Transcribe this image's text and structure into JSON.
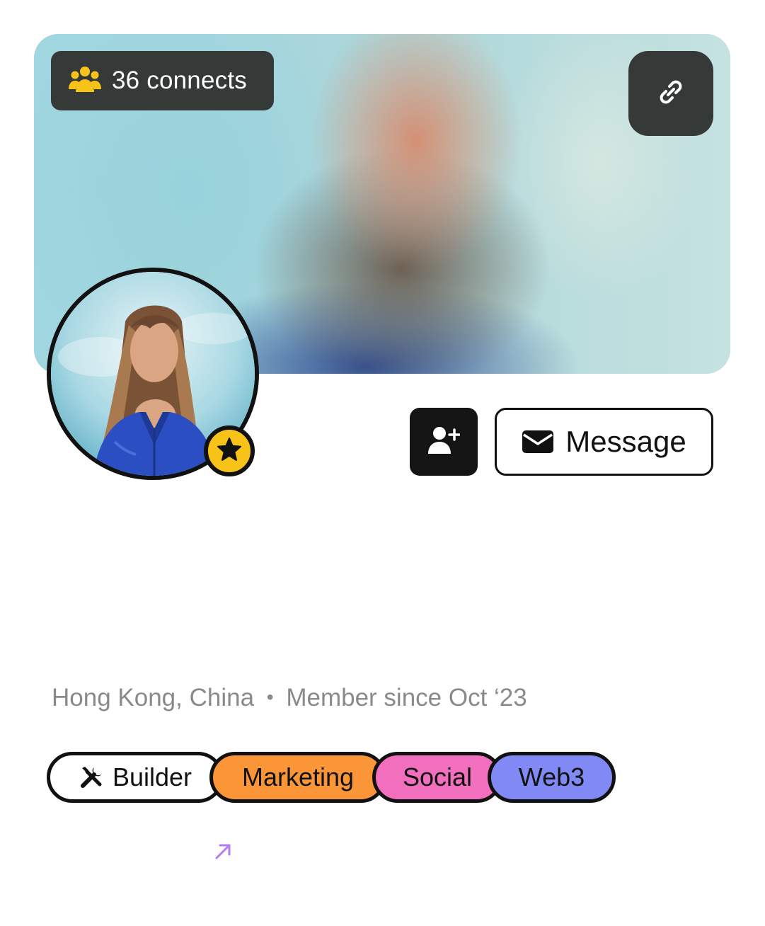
{
  "profile": {
    "connects_label": "36 connects",
    "location": "Hong Kong, China",
    "separator": "•",
    "member_since": "Member since Oct ‘23"
  },
  "actions": {
    "message_label": "Message"
  },
  "tags": [
    {
      "label": "Builder",
      "color": "#ffffff",
      "icon": "tools-icon"
    },
    {
      "label": "Marketing",
      "color": "#fb9638"
    },
    {
      "label": "Social",
      "color": "#f26fbd"
    },
    {
      "label": "Web3",
      "color": "#8089f4"
    }
  ],
  "icons": {
    "connects": "group-icon",
    "share": "link-icon",
    "badge": "star-icon",
    "connect": "add-user-icon",
    "message": "envelope-icon",
    "arrow": "arrow-up-right-icon"
  },
  "colors": {
    "dark_pill": "#353a39",
    "accent_yellow": "#f7c319",
    "arrow_purple": "#b57cf0"
  }
}
